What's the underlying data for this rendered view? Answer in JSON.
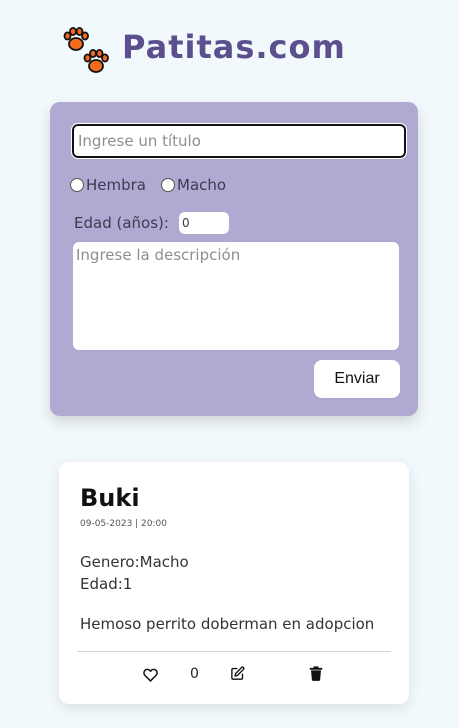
{
  "header": {
    "logo_text": "Patitas.com",
    "logo_icon": "paw-icon",
    "brand_color": "#5c4f8e",
    "paw_color": "#f26a1b"
  },
  "form": {
    "background_color": "#b0aad3",
    "title_placeholder": "Ingrese un título",
    "title_value": "",
    "gender_options": [
      "Hembra",
      "Macho"
    ],
    "gender_selected": "",
    "age_label": "Edad (años):",
    "age_value": "0",
    "description_placeholder": "Ingrese la descripción",
    "description_value": "",
    "submit_label": "Enviar"
  },
  "post": {
    "title": "Buki",
    "date": "09-05-2023 | 20:00",
    "gender": "Genero:Macho",
    "age": "Edad:1",
    "description": "Hemoso perrito doberman en adopcion",
    "likes": "0",
    "actions": {
      "like_icon": "heart-icon",
      "edit_icon": "edit-icon",
      "delete_icon": "trash-icon"
    }
  }
}
